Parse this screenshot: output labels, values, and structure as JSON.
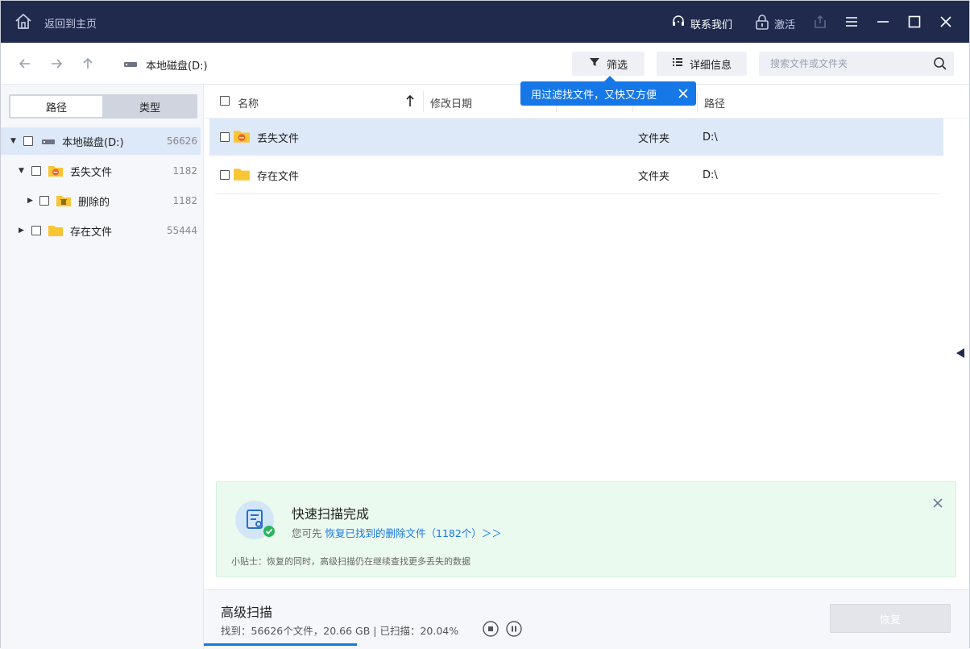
{
  "titlebar": {
    "home_label": "返回到主页",
    "contact_label": "联系我们",
    "activate_label": "激活"
  },
  "toolbar": {
    "drive_label": "本地磁盘(D:)",
    "filter_label": "筛选",
    "detail_label": "详细信息",
    "search_placeholder": "搜索文件或文件夹"
  },
  "tooltip": {
    "text": "用过滤找文件，又快又方便"
  },
  "sidebar": {
    "tab_path": "路径",
    "tab_type": "类型",
    "tree": [
      {
        "label": "本地磁盘(D:)",
        "count": "56626"
      },
      {
        "label": "丢失文件",
        "count": "1182"
      },
      {
        "label": "删除的",
        "count": "1182"
      },
      {
        "label": "存在文件",
        "count": "55444"
      }
    ]
  },
  "table": {
    "headers": {
      "name": "名称",
      "modified": "修改日期",
      "path": "路径"
    },
    "rows": [
      {
        "name": "丢失文件",
        "type": "文件夹",
        "path": "D:\\"
      },
      {
        "name": "存在文件",
        "type": "文件夹",
        "path": "D:\\"
      }
    ]
  },
  "notice": {
    "title": "快速扫描完成",
    "sub_prefix": "您可先",
    "sub_link": "恢复已找到的删除文件（1182个）＞＞",
    "tip": "小贴士：恢复的同时，高级扫描仍在继续查找更多丢失的数据"
  },
  "bottom": {
    "title": "高级扫描",
    "stats": "找到：56626个文件，20.66 GB | 已扫描：20.04%",
    "progress": 0.2004,
    "recover_label": "恢复"
  },
  "colors": {
    "titlebar": "#1f2a4d",
    "accent": "#1677e6",
    "folder": "#f8c533",
    "notice_bg": "#ebfaef",
    "selected_row": "#dde8f8"
  }
}
